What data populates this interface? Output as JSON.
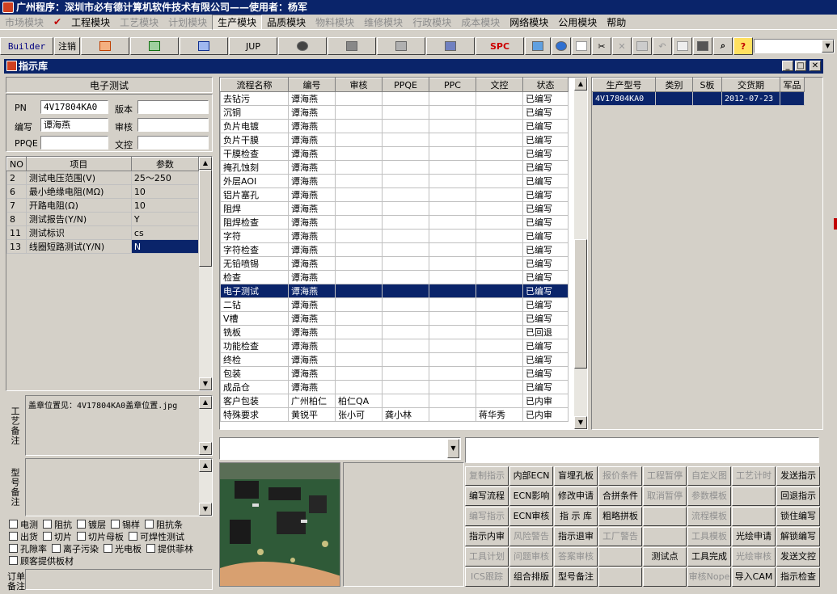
{
  "title": "广州程序：深圳市必有德计算机软件技术有限公司——使用者：杨军",
  "menu": [
    {
      "label": "市场模块",
      "state": "dis"
    },
    {
      "label": "✔",
      "state": "check"
    },
    {
      "label": "工程模块",
      "state": ""
    },
    {
      "label": "工艺模块",
      "state": "dis"
    },
    {
      "label": "计划模块",
      "state": "dis"
    },
    {
      "label": "生产模块",
      "state": "active"
    },
    {
      "label": "品质模块",
      "state": ""
    },
    {
      "label": "物料模块",
      "state": "dis"
    },
    {
      "label": "维修模块",
      "state": "dis"
    },
    {
      "label": "行政模块",
      "state": "dis"
    },
    {
      "label": "成本模块",
      "state": "dis"
    },
    {
      "label": "网络模块",
      "state": ""
    },
    {
      "label": "公用模块",
      "state": ""
    },
    {
      "label": "帮助",
      "state": ""
    }
  ],
  "toolbar": {
    "builder": "Builder",
    "logout": "注销",
    "jup": "JUP",
    "spc": "SPC",
    "help": "?"
  },
  "window": {
    "title": "指示库"
  },
  "left": {
    "heading": "电子测试",
    "pn_label": "PN",
    "pn_value": "4V17804KA0",
    "version_label": "版本",
    "version_value": "",
    "writer_label": "编写",
    "writer_value": "谭海燕",
    "review_label": "审核",
    "review_value": "",
    "ppqe_label": "PPQE",
    "ppqe_value": "",
    "doc_label": "文控",
    "doc_value": "",
    "params_head": [
      "NO",
      "项目",
      "参数"
    ],
    "params": [
      {
        "no": "2",
        "item": "测试电压范围(V)",
        "val": "25～250"
      },
      {
        "no": "6",
        "item": "最小绝缘电阻(MΩ)",
        "val": "10"
      },
      {
        "no": "7",
        "item": "开路电阻(Ω)",
        "val": "10"
      },
      {
        "no": "8",
        "item": "测试报告(Y/N)",
        "val": "Y"
      },
      {
        "no": "11",
        "item": "测试标识",
        "val": "cs"
      },
      {
        "no": "13",
        "item": "线圈短路测试(Y/N)",
        "val": "N"
      }
    ],
    "craft_label": "工艺备注",
    "craft_note": "盖章位置见：4V17804KA0盖章位置.jpg",
    "model_label": "型号备注",
    "model_note": "",
    "order_label": "订单备注",
    "checks": [
      [
        "电测",
        "阻抗",
        "镀层",
        "锡样",
        "阻抗条"
      ],
      [
        "出货",
        "切片",
        "切片母板",
        "可焊性测试"
      ],
      [
        "孔隙率",
        "离子污染",
        "光电板",
        "提供菲林"
      ],
      [
        "顾客提供板材"
      ]
    ]
  },
  "flow": {
    "headers": [
      "流程名称",
      "编号",
      "审核",
      "PPQE",
      "PPC",
      "文控",
      "状态"
    ],
    "rows": [
      [
        "去钻污",
        "谭海燕",
        "",
        "",
        "",
        "",
        "已编写"
      ],
      [
        "沉铜",
        "谭海燕",
        "",
        "",
        "",
        "",
        "已编写"
      ],
      [
        "负片电镀",
        "谭海燕",
        "",
        "",
        "",
        "",
        "已编写"
      ],
      [
        "负片干膜",
        "谭海燕",
        "",
        "",
        "",
        "",
        "已编写"
      ],
      [
        "干膜检查",
        "谭海燕",
        "",
        "",
        "",
        "",
        "已编写"
      ],
      [
        "掩孔蚀刻",
        "谭海燕",
        "",
        "",
        "",
        "",
        "已编写"
      ],
      [
        "外层AOI",
        "谭海燕",
        "",
        "",
        "",
        "",
        "已编写"
      ],
      [
        "铝片塞孔",
        "谭海燕",
        "",
        "",
        "",
        "",
        "已编写"
      ],
      [
        "阻焊",
        "谭海燕",
        "",
        "",
        "",
        "",
        "已编写"
      ],
      [
        "阻焊检查",
        "谭海燕",
        "",
        "",
        "",
        "",
        "已编写"
      ],
      [
        "字符",
        "谭海燕",
        "",
        "",
        "",
        "",
        "已编写"
      ],
      [
        "字符检查",
        "谭海燕",
        "",
        "",
        "",
        "",
        "已编写"
      ],
      [
        "无铅喷锡",
        "谭海燕",
        "",
        "",
        "",
        "",
        "已编写"
      ],
      [
        "检查",
        "谭海燕",
        "",
        "",
        "",
        "",
        "已编写"
      ],
      [
        "电子测试",
        "谭海燕",
        "",
        "",
        "",
        "",
        "已编写"
      ],
      [
        "二钻",
        "谭海燕",
        "",
        "",
        "",
        "",
        "已编写"
      ],
      [
        "V槽",
        "谭海燕",
        "",
        "",
        "",
        "",
        "已编写"
      ],
      [
        "铣板",
        "谭海燕",
        "",
        "",
        "",
        "",
        "已回退"
      ],
      [
        "功能检查",
        "谭海燕",
        "",
        "",
        "",
        "",
        "已编写"
      ],
      [
        "终检",
        "谭海燕",
        "",
        "",
        "",
        "",
        "已编写"
      ],
      [
        "包装",
        "谭海燕",
        "",
        "",
        "",
        "",
        "已编写"
      ],
      [
        "成品仓",
        "谭海燕",
        "",
        "",
        "",
        "",
        "已编写"
      ],
      [
        "客户包装",
        "广州柏仁",
        "柏仁QA",
        "",
        "",
        "",
        "已内审"
      ],
      [
        "特殊要求",
        "黄锐平",
        "张小可",
        "龚小林",
        "",
        "蒋华秀",
        "已内审"
      ]
    ]
  },
  "models": {
    "headers": [
      "生产型号",
      "类别",
      "S板",
      "交货期",
      "军品"
    ],
    "rows": [
      [
        "4V17804KA0",
        "",
        "",
        "2012-07-23",
        ""
      ]
    ]
  },
  "buttons": [
    [
      {
        "l": "复制指示",
        "d": true
      },
      {
        "l": "内部ECN",
        "d": false
      },
      {
        "l": "盲埋孔板",
        "d": false
      },
      {
        "l": "报价条件",
        "d": true
      },
      {
        "l": "工程暂停",
        "d": true
      },
      {
        "l": "自定义图",
        "d": true
      },
      {
        "l": "工艺计时",
        "d": true
      },
      {
        "l": "发送指示",
        "d": false
      }
    ],
    [
      {
        "l": "编写流程",
        "d": false
      },
      {
        "l": "ECN影响",
        "d": false
      },
      {
        "l": "修改申请",
        "d": false
      },
      {
        "l": "合拼条件",
        "d": false
      },
      {
        "l": "取消暂停",
        "d": true
      },
      {
        "l": "参数模板",
        "d": true
      },
      {
        "l": "",
        "d": true
      },
      {
        "l": "回退指示",
        "d": false
      }
    ],
    [
      {
        "l": "编写指示",
        "d": true
      },
      {
        "l": "ECN审核",
        "d": false
      },
      {
        "l": "指 示 库",
        "d": false
      },
      {
        "l": "粗略拼板",
        "d": false
      },
      {
        "l": "",
        "d": true
      },
      {
        "l": "流程模板",
        "d": true
      },
      {
        "l": "",
        "d": true
      },
      {
        "l": "锁住编写",
        "d": false
      }
    ],
    [
      {
        "l": "指示内审",
        "d": false
      },
      {
        "l": "风险警告",
        "d": true
      },
      {
        "l": "指示退审",
        "d": false
      },
      {
        "l": "工厂警告",
        "d": true
      },
      {
        "l": "",
        "d": true
      },
      {
        "l": "工具模板",
        "d": true
      },
      {
        "l": "光绘申请",
        "d": false
      },
      {
        "l": "解锁编写",
        "d": false
      }
    ],
    [
      {
        "l": "工具计划",
        "d": true
      },
      {
        "l": "问题审核",
        "d": true
      },
      {
        "l": "答案审核",
        "d": true
      },
      {
        "l": "",
        "d": true
      },
      {
        "l": "测试点",
        "d": false
      },
      {
        "l": "工具完成",
        "d": false
      },
      {
        "l": "光绘审核",
        "d": true
      },
      {
        "l": "发送文控",
        "d": false
      }
    ],
    [
      {
        "l": "ICS跟踪",
        "d": true
      },
      {
        "l": "组合排版",
        "d": false
      },
      {
        "l": "型号备注",
        "d": false
      },
      {
        "l": "",
        "d": true
      },
      {
        "l": "",
        "d": true
      },
      {
        "l": "审核Nope",
        "d": true
      },
      {
        "l": "导入CAM",
        "d": false
      },
      {
        "l": "指示检查",
        "d": false
      }
    ]
  ],
  "colors": {
    "title_bg": "#0a246a",
    "face": "#d4d0c8",
    "select": "#0a246a"
  }
}
